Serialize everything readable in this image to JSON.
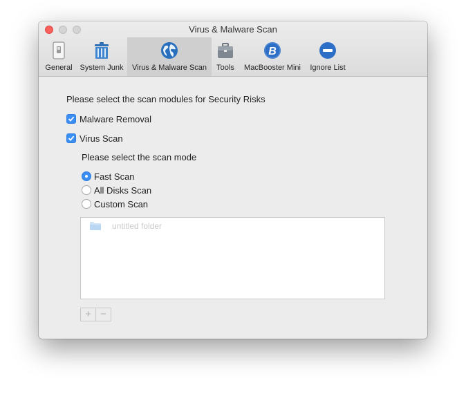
{
  "window": {
    "title": "Virus & Malware Scan"
  },
  "toolbar": {
    "tabs": [
      {
        "label": "General",
        "icon": "general-switch-icon"
      },
      {
        "label": "System Junk",
        "icon": "trash-bin-icon"
      },
      {
        "label": "Virus & Malware Scan",
        "icon": "globe-icon",
        "active": true
      },
      {
        "label": "Tools",
        "icon": "toolbox-icon"
      },
      {
        "label": "MacBooster Mini",
        "icon": "macbooster-b-icon"
      },
      {
        "label": "Ignore List",
        "icon": "minus-circle-icon"
      }
    ]
  },
  "scan": {
    "modules_heading": "Please select the scan modules for Security Risks",
    "modules": [
      {
        "label": "Malware Removal",
        "checked": true
      },
      {
        "label": "Virus Scan",
        "checked": true
      }
    ],
    "mode_heading": "Please select the scan mode",
    "modes": [
      {
        "label": "Fast Scan",
        "selected": true
      },
      {
        "label": "All Disks Scan",
        "selected": false
      },
      {
        "label": "Custom Scan",
        "selected": false
      }
    ],
    "folders": [
      {
        "label": "untitled folder"
      }
    ],
    "add_label": "+",
    "remove_label": "−"
  },
  "colors": {
    "accent": "#3b8ef4",
    "close": "#fc605c",
    "active_tab": "#cfcfcf"
  }
}
